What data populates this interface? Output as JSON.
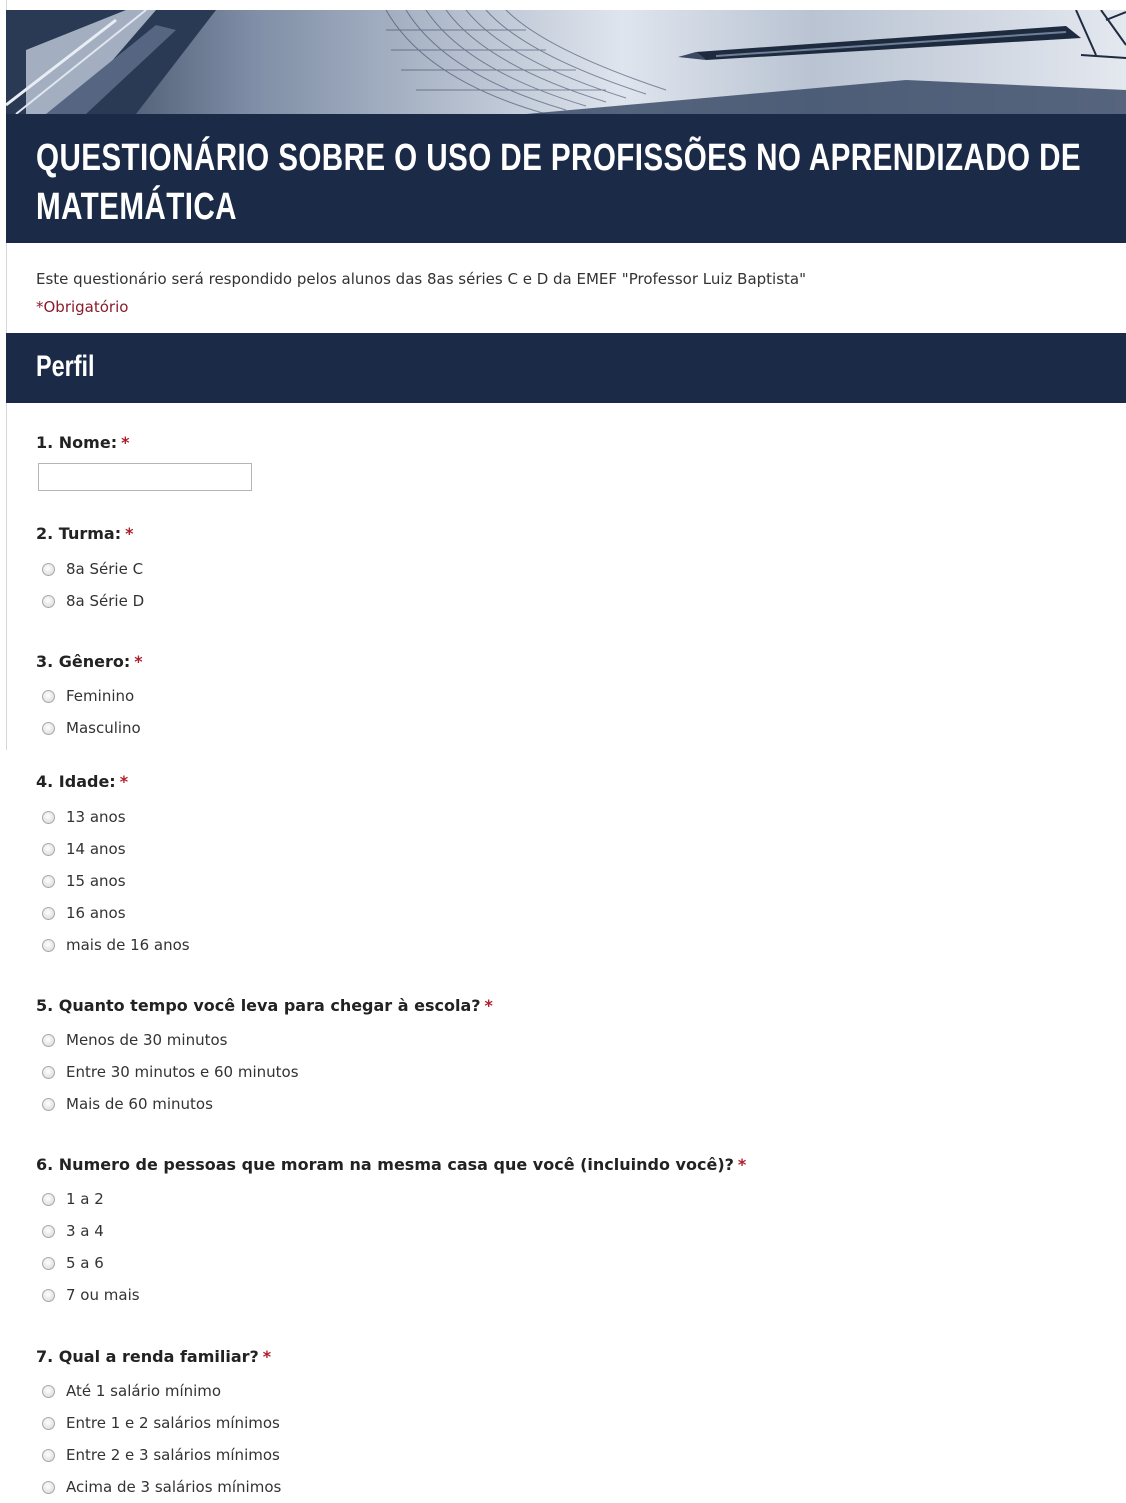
{
  "form": {
    "title": "QUESTIONÁRIO SOBRE O USO DE PROFISSÕES NO APRENDIZADO DE MATEMÁTICA",
    "description": "Este questionário será respondido pelos alunos das 8as séries C e D da EMEF \"Professor Luiz Baptista\"",
    "required_note": "*Obrigatório"
  },
  "section": {
    "title": "Perfil"
  },
  "questions": [
    {
      "label": "1. Nome:",
      "required": "*",
      "type": "text",
      "value": ""
    },
    {
      "label": "2. Turma:",
      "required": "*",
      "type": "radio",
      "options": [
        "8a Série C",
        "8a Série D"
      ]
    },
    {
      "label": "3. Gênero:",
      "required": "*",
      "type": "radio",
      "options": [
        "Feminino",
        "Masculino"
      ]
    },
    {
      "label": "4. Idade:",
      "required": "*",
      "type": "radio",
      "options": [
        "13 anos",
        "14 anos",
        "15 anos",
        "16 anos",
        "mais de 16 anos"
      ]
    },
    {
      "label": "5. Quanto tempo você leva para chegar à escola?",
      "required": "*",
      "type": "radio",
      "options": [
        "Menos de 30 minutos",
        "Entre 30 minutos e 60 minutos",
        "Mais de 60 minutos"
      ]
    },
    {
      "label": "6. Numero de pessoas que moram na mesma casa que você (incluindo você)?",
      "required": "*",
      "type": "radio",
      "options": [
        "1 a 2",
        "3 a 4",
        "5 a 6",
        "7 ou mais"
      ]
    },
    {
      "label": "7. Qual a renda familiar?",
      "required": "*",
      "type": "radio",
      "options": [
        "Até 1 salário mínimo",
        "Entre 1 e 2 salários mínimos",
        "Entre 2 e 3 salários mínimos",
        "Acima de 3 salários mínimos"
      ]
    }
  ],
  "colors": {
    "header_bg": "#1b2a47",
    "required": "#b01d2a",
    "required_note": "#8a1c2c"
  },
  "icons": {
    "banner": "drafting-pencil-ruler-banner",
    "option_marker": "radio-button"
  }
}
